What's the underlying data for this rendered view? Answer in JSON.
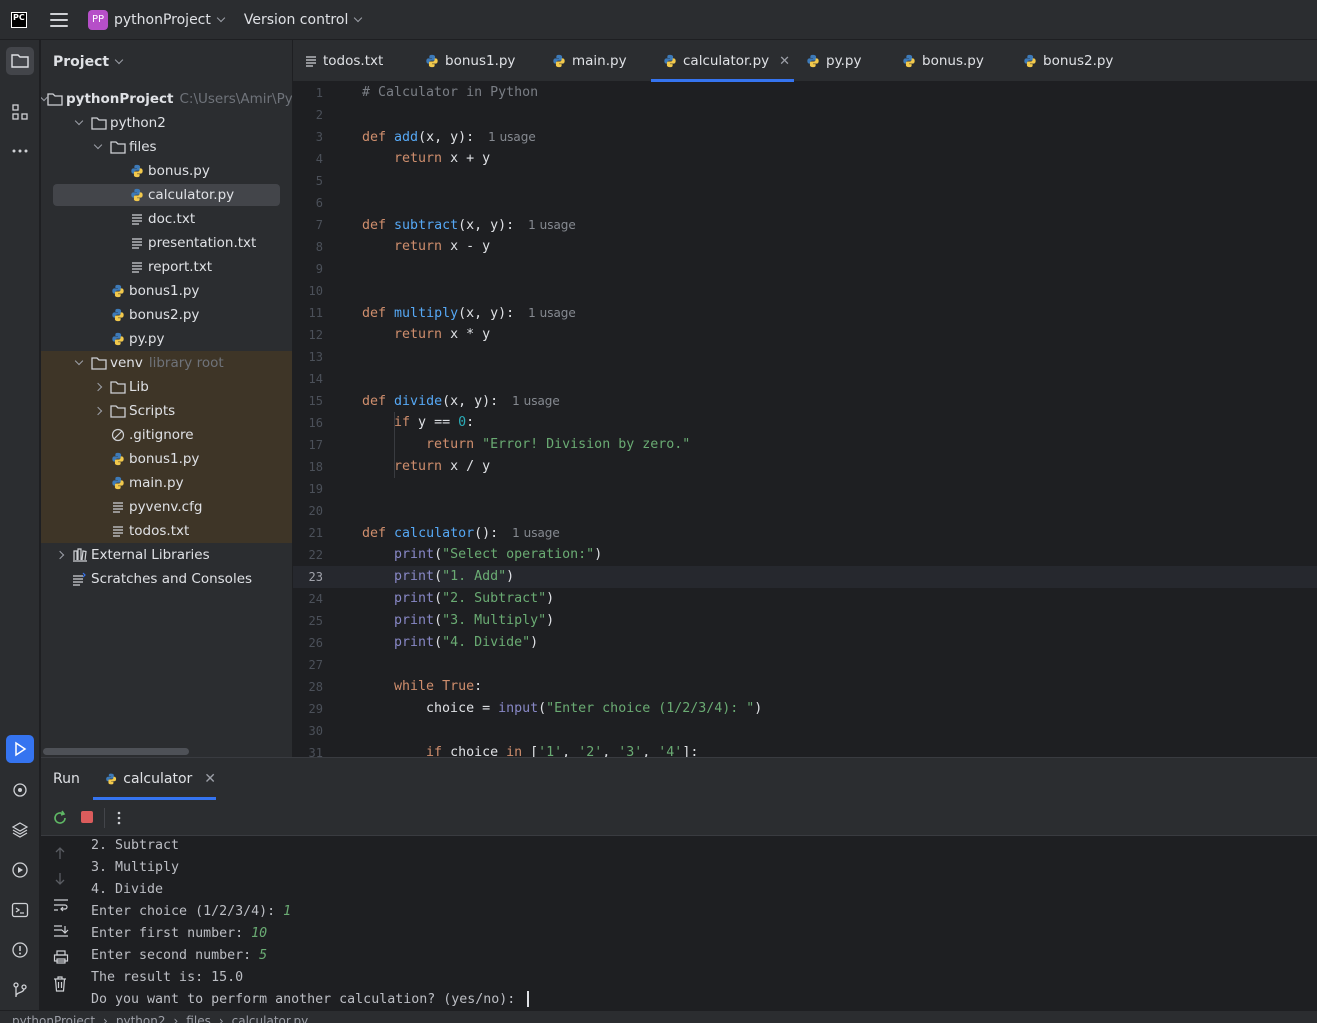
{
  "titlebar": {
    "logo": "PC",
    "project_badge": "PP",
    "project_name": "pythonProject",
    "vcs_label": "Version control"
  },
  "project_panel": {
    "title": "Project",
    "tree": [
      {
        "label": "pythonProject",
        "hint": "C:\\Users\\Amir\\Py",
        "type": "folder",
        "depth": 0,
        "expanded": true,
        "bold": true
      },
      {
        "label": "python2",
        "type": "folder",
        "depth": 1,
        "expanded": true
      },
      {
        "label": "files",
        "type": "folder",
        "depth": 2,
        "expanded": true
      },
      {
        "label": "bonus.py",
        "type": "python",
        "depth": 3
      },
      {
        "label": "calculator.py",
        "type": "python",
        "depth": 3,
        "selected": true
      },
      {
        "label": "doc.txt",
        "type": "text",
        "depth": 3
      },
      {
        "label": "presentation.txt",
        "type": "text",
        "depth": 3
      },
      {
        "label": "report.txt",
        "type": "text",
        "depth": 3
      },
      {
        "label": "bonus1.py",
        "type": "python",
        "depth": 2
      },
      {
        "label": "bonus2.py",
        "type": "python",
        "depth": 2
      },
      {
        "label": "py.py",
        "type": "python",
        "depth": 2
      },
      {
        "label": "venv",
        "hint": "library root",
        "type": "folder",
        "depth": 1,
        "expanded": true,
        "venv": true
      },
      {
        "label": "Lib",
        "type": "folder",
        "depth": 2,
        "expanded": false,
        "venv": true
      },
      {
        "label": "Scripts",
        "type": "folder",
        "depth": 2,
        "expanded": false,
        "venv": true
      },
      {
        "label": ".gitignore",
        "type": "ignore",
        "depth": 2,
        "venv": true
      },
      {
        "label": "bonus1.py",
        "type": "python",
        "depth": 2,
        "venv": true
      },
      {
        "label": "main.py",
        "type": "python",
        "depth": 2,
        "venv": true
      },
      {
        "label": "pyvenv.cfg",
        "type": "text",
        "depth": 2,
        "venv": true
      },
      {
        "label": "todos.txt",
        "type": "text",
        "depth": 2,
        "venv": true
      },
      {
        "label": "External Libraries",
        "type": "library",
        "depth": 0,
        "expanded": false
      },
      {
        "label": "Scratches and Consoles",
        "type": "scratch",
        "depth": 0
      }
    ]
  },
  "tabs": [
    {
      "label": "todos.txt",
      "type": "text"
    },
    {
      "label": "bonus1.py",
      "type": "python"
    },
    {
      "label": "main.py",
      "type": "python"
    },
    {
      "label": "calculator.py",
      "type": "python",
      "active": true
    },
    {
      "label": "py.py",
      "type": "python"
    },
    {
      "label": "bonus.py",
      "type": "python"
    },
    {
      "label": "bonus2.py",
      "type": "python"
    }
  ],
  "editor": {
    "current_line": 23,
    "usage_hint": "1 usage",
    "lines": [
      "# Calculator in Python",
      "",
      "def add(x, y):",
      "    return x + y",
      "",
      "",
      "def subtract(x, y):",
      "    return x - y",
      "",
      "",
      "def multiply(x, y):",
      "    return x * y",
      "",
      "",
      "def divide(x, y):",
      "    if y == 0:",
      "        return \"Error! Division by zero.\"",
      "    return x / y",
      "",
      "",
      "def calculator():",
      "    print(\"Select operation:\")",
      "    print(\"1. Add\")",
      "    print(\"2. Subtract\")",
      "    print(\"3. Multiply\")",
      "    print(\"4. Divide\")",
      "",
      "    while True:",
      "        choice = input(\"Enter choice (1/2/3/4): \")",
      "",
      "        if choice in ['1', '2', '3', '4']:"
    ],
    "usage_lines": [
      3,
      7,
      11,
      15,
      21
    ]
  },
  "run_window": {
    "title": "Run",
    "tab_label": "calculator",
    "console": [
      {
        "text": "2. Subtract"
      },
      {
        "text": "3. Multiply"
      },
      {
        "text": "4. Divide"
      },
      {
        "text": "Enter choice (1/2/3/4): ",
        "input": "1"
      },
      {
        "text": "Enter first number: ",
        "input": "10"
      },
      {
        "text": "Enter second number: ",
        "input": "5"
      },
      {
        "text": "The result is: 15.0"
      },
      {
        "text": "Do you want to perform another calculation? (yes/no): ",
        "cursor": true
      }
    ]
  },
  "statusbar": {
    "breadcrumbs": [
      "pythonProject",
      "python2",
      "files",
      "calculator.py"
    ]
  },
  "colors": {
    "accent": "#3574f0",
    "keyword": "#cf8e6d",
    "function": "#56a8f5",
    "string": "#6aab73",
    "number": "#2aacb8"
  }
}
